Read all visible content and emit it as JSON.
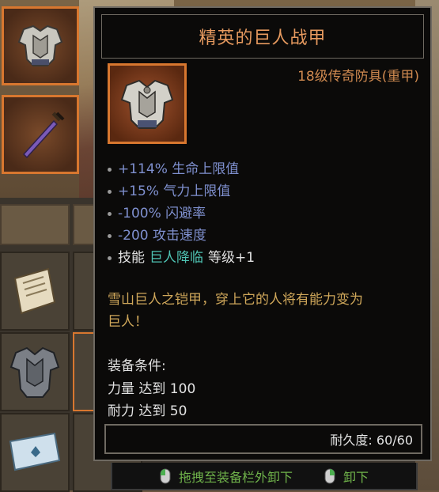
{
  "tooltip": {
    "title": "精英的巨人战甲",
    "item_type": "18级传奇防具(重甲)",
    "stats": [
      "+114% 生命上限值",
      "+15% 气力上限值",
      "-100% 闪避率",
      "-200 攻击速度"
    ],
    "skill": {
      "prefix": "技能",
      "name": "巨人降临",
      "suffix": "等级+1"
    },
    "flavor_line1": "雪山巨人之铠甲，穿上它的人将有能力变为",
    "flavor_line2": "巨人！",
    "requirements_title": "装备条件:",
    "requirements": [
      "力量 达到 100",
      "耐力 达到 50"
    ],
    "durability": "耐久度: 60/60"
  },
  "hints": {
    "drag_unequip": "拖拽至装备栏外卸下",
    "unequip": "卸下"
  },
  "icons": {
    "armor": "plate-armor-icon",
    "sword": "sword-icon",
    "tab": "scroll-tab-icon",
    "scroll": "scroll-icon",
    "map": "map-icon",
    "mouse": "mouse-icon"
  },
  "colors": {
    "title": "#e79a5f",
    "stat": "#7f90cf",
    "skill_name": "#4fc4b4",
    "flavor": "#cfa75a",
    "frame": "#d8772f",
    "hint": "#6fb24a"
  }
}
